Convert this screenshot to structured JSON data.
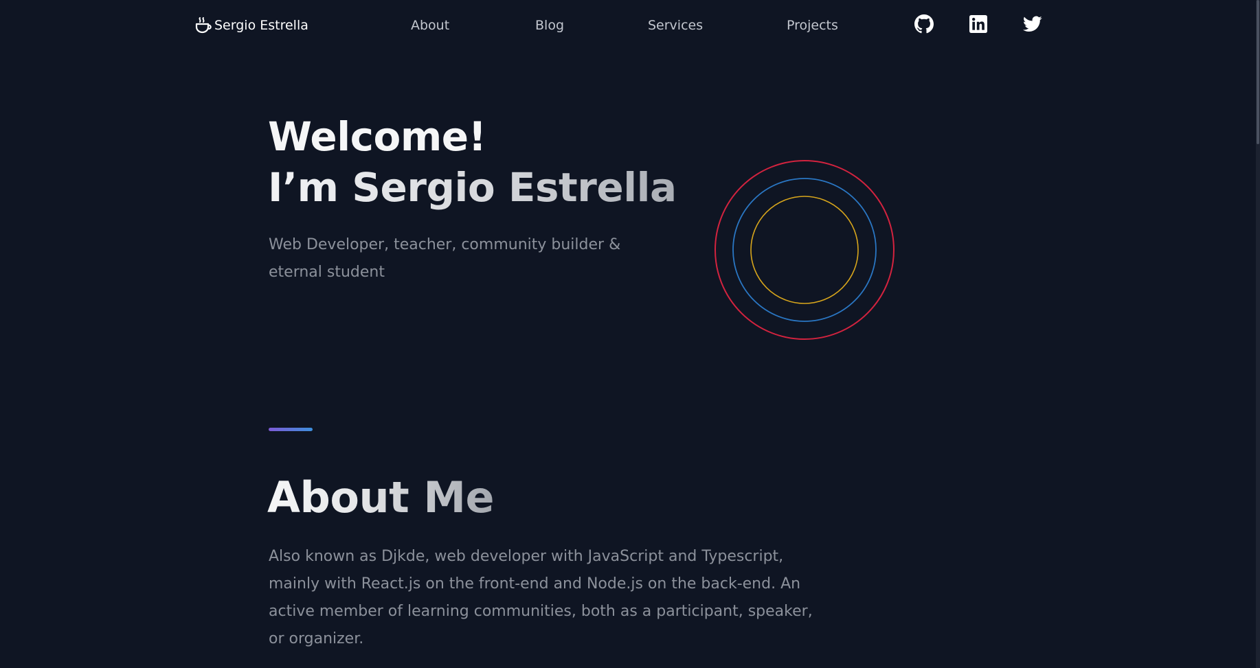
{
  "colors": {
    "background": "#0f1523",
    "ring_outer": "#d3233f",
    "ring_middle": "#2a77c4",
    "ring_inner": "#d8a61c",
    "divider_start": "#7e5bd6",
    "divider_end": "#3d8fdc"
  },
  "header": {
    "brand_icon": "coffee-cup-icon",
    "brand_name": "Sergio Estrella",
    "nav": [
      {
        "label": "About"
      },
      {
        "label": "Blog"
      },
      {
        "label": "Services"
      },
      {
        "label": "Projects"
      }
    ],
    "social": [
      {
        "icon": "github-icon"
      },
      {
        "icon": "linkedin-icon"
      },
      {
        "icon": "twitter-icon"
      }
    ]
  },
  "hero": {
    "title_line1": "Welcome!",
    "title_line2": "I’m Sergio Estrella",
    "subtitle": "Web Developer, teacher, community builder & eternal student"
  },
  "about": {
    "title": "About Me",
    "text": "Also known as Djkde, web developer with JavaScript and Typescript, mainly with React.js on the front-end and Node.js on the back-end. An active member of learning communities, both as a participant, speaker, or organizer."
  }
}
